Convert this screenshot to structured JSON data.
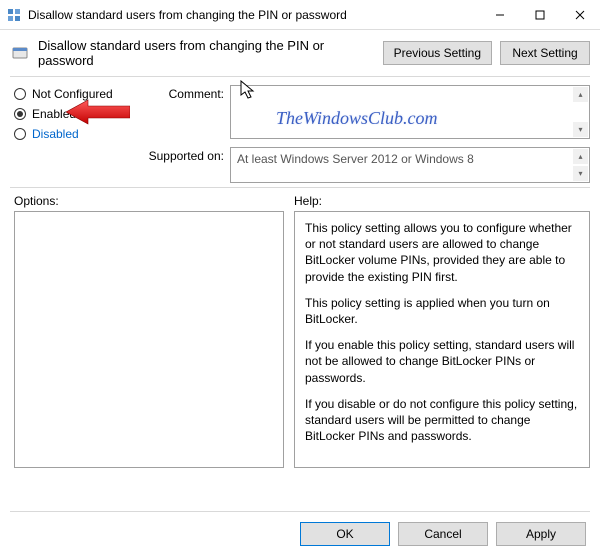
{
  "window": {
    "title": "Disallow standard users from changing the PIN or password"
  },
  "header": {
    "title": "Disallow standard users from changing the PIN or password",
    "prev_button": "Previous Setting",
    "next_button": "Next Setting"
  },
  "state": {
    "not_configured_label": "Not Configured",
    "enabled_label": "Enabled",
    "disabled_label": "Disabled",
    "selected": "enabled"
  },
  "fields": {
    "comment_label": "Comment:",
    "comment_value": "",
    "supported_label": "Supported on:",
    "supported_value": "At least Windows Server 2012 or Windows 8"
  },
  "panels": {
    "options_label": "Options:",
    "help_label": "Help:",
    "help_paragraphs": [
      "This policy setting allows you to configure whether or not standard users are allowed to change BitLocker volume PINs, provided they are able to provide the existing PIN first.",
      "This policy setting is applied when you turn on BitLocker.",
      "If you enable this policy setting, standard users will not be allowed to change BitLocker PINs or passwords.",
      "If you disable or do not configure this policy setting, standard users will be permitted to change BitLocker PINs and passwords."
    ]
  },
  "buttons": {
    "ok": "OK",
    "cancel": "Cancel",
    "apply": "Apply"
  },
  "watermark": "TheWindowsClub.com"
}
